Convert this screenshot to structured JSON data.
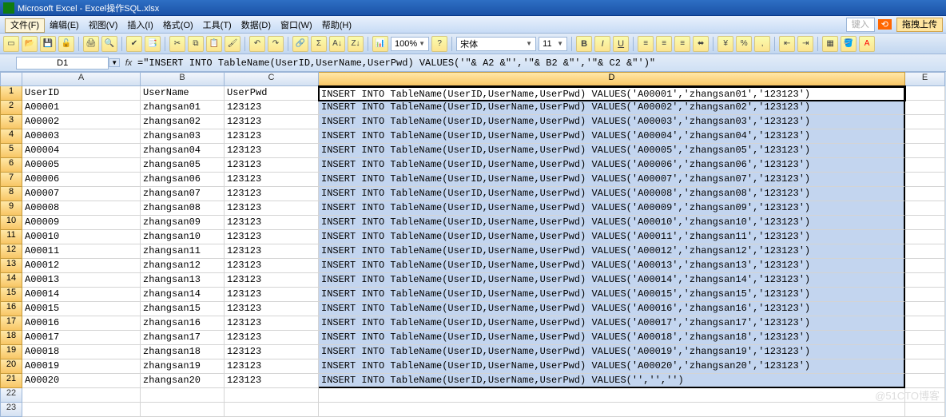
{
  "title": "Microsoft Excel - Excel操作SQL.xlsx",
  "menu": [
    "文件(F)",
    "编辑(E)",
    "视图(V)",
    "插入(I)",
    "格式(O)",
    "工具(T)",
    "数据(D)",
    "窗口(W)",
    "帮助(H)"
  ],
  "helpbox_placeholder": "键入",
  "widget_after": "拖拽上传",
  "font": {
    "name": "宋体",
    "size": "11"
  },
  "nameBox": "D1",
  "formula": "=\"INSERT INTO TableName(UserID,UserName,UserPwd) VALUES('\"& A2 &\"','\"& B2 &\"','\"& C2 &\"')\"",
  "zoom": "100%",
  "columns": [
    "A",
    "B",
    "C",
    "D",
    "E"
  ],
  "headers": {
    "A": "UserID",
    "B": "UserName",
    "C": "UserPwd"
  },
  "rows": [
    {
      "n": 1,
      "a": "UserID",
      "b": "UserName",
      "c": "UserPwd",
      "d": "INSERT INTO TableName(UserID,UserName,UserPwd) VALUES('A00001','zhangsan01','123123')"
    },
    {
      "n": 2,
      "a": "A00001",
      "b": "zhangsan01",
      "c": "123123",
      "d": "INSERT INTO TableName(UserID,UserName,UserPwd) VALUES('A00002','zhangsan02','123123')"
    },
    {
      "n": 3,
      "a": "A00002",
      "b": "zhangsan02",
      "c": "123123",
      "d": "INSERT INTO TableName(UserID,UserName,UserPwd) VALUES('A00003','zhangsan03','123123')"
    },
    {
      "n": 4,
      "a": "A00003",
      "b": "zhangsan03",
      "c": "123123",
      "d": "INSERT INTO TableName(UserID,UserName,UserPwd) VALUES('A00004','zhangsan04','123123')"
    },
    {
      "n": 5,
      "a": "A00004",
      "b": "zhangsan04",
      "c": "123123",
      "d": "INSERT INTO TableName(UserID,UserName,UserPwd) VALUES('A00005','zhangsan05','123123')"
    },
    {
      "n": 6,
      "a": "A00005",
      "b": "zhangsan05",
      "c": "123123",
      "d": "INSERT INTO TableName(UserID,UserName,UserPwd) VALUES('A00006','zhangsan06','123123')"
    },
    {
      "n": 7,
      "a": "A00006",
      "b": "zhangsan06",
      "c": "123123",
      "d": "INSERT INTO TableName(UserID,UserName,UserPwd) VALUES('A00007','zhangsan07','123123')"
    },
    {
      "n": 8,
      "a": "A00007",
      "b": "zhangsan07",
      "c": "123123",
      "d": "INSERT INTO TableName(UserID,UserName,UserPwd) VALUES('A00008','zhangsan08','123123')"
    },
    {
      "n": 9,
      "a": "A00008",
      "b": "zhangsan08",
      "c": "123123",
      "d": "INSERT INTO TableName(UserID,UserName,UserPwd) VALUES('A00009','zhangsan09','123123')"
    },
    {
      "n": 10,
      "a": "A00009",
      "b": "zhangsan09",
      "c": "123123",
      "d": "INSERT INTO TableName(UserID,UserName,UserPwd) VALUES('A00010','zhangsan10','123123')"
    },
    {
      "n": 11,
      "a": "A00010",
      "b": "zhangsan10",
      "c": "123123",
      "d": "INSERT INTO TableName(UserID,UserName,UserPwd) VALUES('A00011','zhangsan11','123123')"
    },
    {
      "n": 12,
      "a": "A00011",
      "b": "zhangsan11",
      "c": "123123",
      "d": "INSERT INTO TableName(UserID,UserName,UserPwd) VALUES('A00012','zhangsan12','123123')"
    },
    {
      "n": 13,
      "a": "A00012",
      "b": "zhangsan12",
      "c": "123123",
      "d": "INSERT INTO TableName(UserID,UserName,UserPwd) VALUES('A00013','zhangsan13','123123')"
    },
    {
      "n": 14,
      "a": "A00013",
      "b": "zhangsan13",
      "c": "123123",
      "d": "INSERT INTO TableName(UserID,UserName,UserPwd) VALUES('A00014','zhangsan14','123123')"
    },
    {
      "n": 15,
      "a": "A00014",
      "b": "zhangsan14",
      "c": "123123",
      "d": "INSERT INTO TableName(UserID,UserName,UserPwd) VALUES('A00015','zhangsan15','123123')"
    },
    {
      "n": 16,
      "a": "A00015",
      "b": "zhangsan15",
      "c": "123123",
      "d": "INSERT INTO TableName(UserID,UserName,UserPwd) VALUES('A00016','zhangsan16','123123')"
    },
    {
      "n": 17,
      "a": "A00016",
      "b": "zhangsan16",
      "c": "123123",
      "d": "INSERT INTO TableName(UserID,UserName,UserPwd) VALUES('A00017','zhangsan17','123123')"
    },
    {
      "n": 18,
      "a": "A00017",
      "b": "zhangsan17",
      "c": "123123",
      "d": "INSERT INTO TableName(UserID,UserName,UserPwd) VALUES('A00018','zhangsan18','123123')"
    },
    {
      "n": 19,
      "a": "A00018",
      "b": "zhangsan18",
      "c": "123123",
      "d": "INSERT INTO TableName(UserID,UserName,UserPwd) VALUES('A00019','zhangsan19','123123')"
    },
    {
      "n": 20,
      "a": "A00019",
      "b": "zhangsan19",
      "c": "123123",
      "d": "INSERT INTO TableName(UserID,UserName,UserPwd) VALUES('A00020','zhangsan20','123123')"
    },
    {
      "n": 21,
      "a": "A00020",
      "b": "zhangsan20",
      "c": "123123",
      "d": "INSERT INTO TableName(UserID,UserName,UserPwd) VALUES('','','')"
    },
    {
      "n": 22,
      "a": "",
      "b": "",
      "c": "",
      "d": ""
    },
    {
      "n": 23,
      "a": "",
      "b": "",
      "c": "",
      "d": ""
    }
  ],
  "watermark": "@51CTO博客"
}
